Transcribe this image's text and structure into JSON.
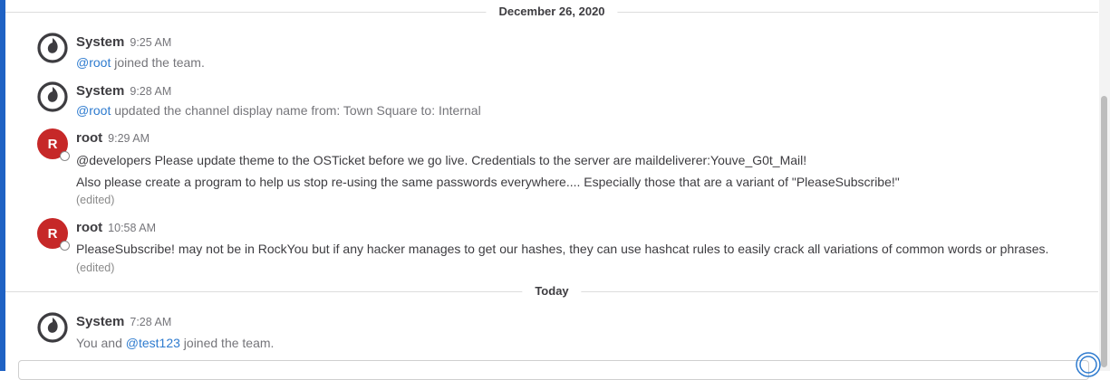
{
  "separators": {
    "first": "December 26, 2020",
    "second": "Today"
  },
  "posts": [
    {
      "author": "System",
      "time": "9:25 AM",
      "mention": "@root",
      "text": " joined the team."
    },
    {
      "author": "System",
      "time": "9:28 AM",
      "mention": "@root",
      "text": " updated the channel display name from: Town Square to: Internal"
    },
    {
      "author": "root",
      "avatar_letter": "R",
      "time": "9:29 AM",
      "line1": "@developers Please update theme to the OSTicket before we go live.  Credentials to the server are maildeliverer:Youve_G0t_Mail!",
      "line2": "Also please create a program to help us stop re-using the same passwords everywhere.... Especially those that are a variant of \"PleaseSubscribe!\"",
      "edited": "(edited)"
    },
    {
      "author": "root",
      "avatar_letter": "R",
      "time": "10:58 AM",
      "line1": "PleaseSubscribe! may not be in RockYou but if any hacker manages to get our hashes, they can use hashcat rules to easily crack all variations of common words or phrases.",
      "edited": "(edited)"
    },
    {
      "author": "System",
      "time": "7:28 AM",
      "prefix": "You and ",
      "mention": "@test123",
      "text": " joined the team."
    }
  ],
  "icons": {
    "system_avatar": "mattermost-logo-icon",
    "corner": "loading-ring-icon"
  },
  "colors": {
    "accent_bar": "#1f62c4",
    "mention": "#2e7bcf",
    "user_avatar": "#c62828"
  }
}
